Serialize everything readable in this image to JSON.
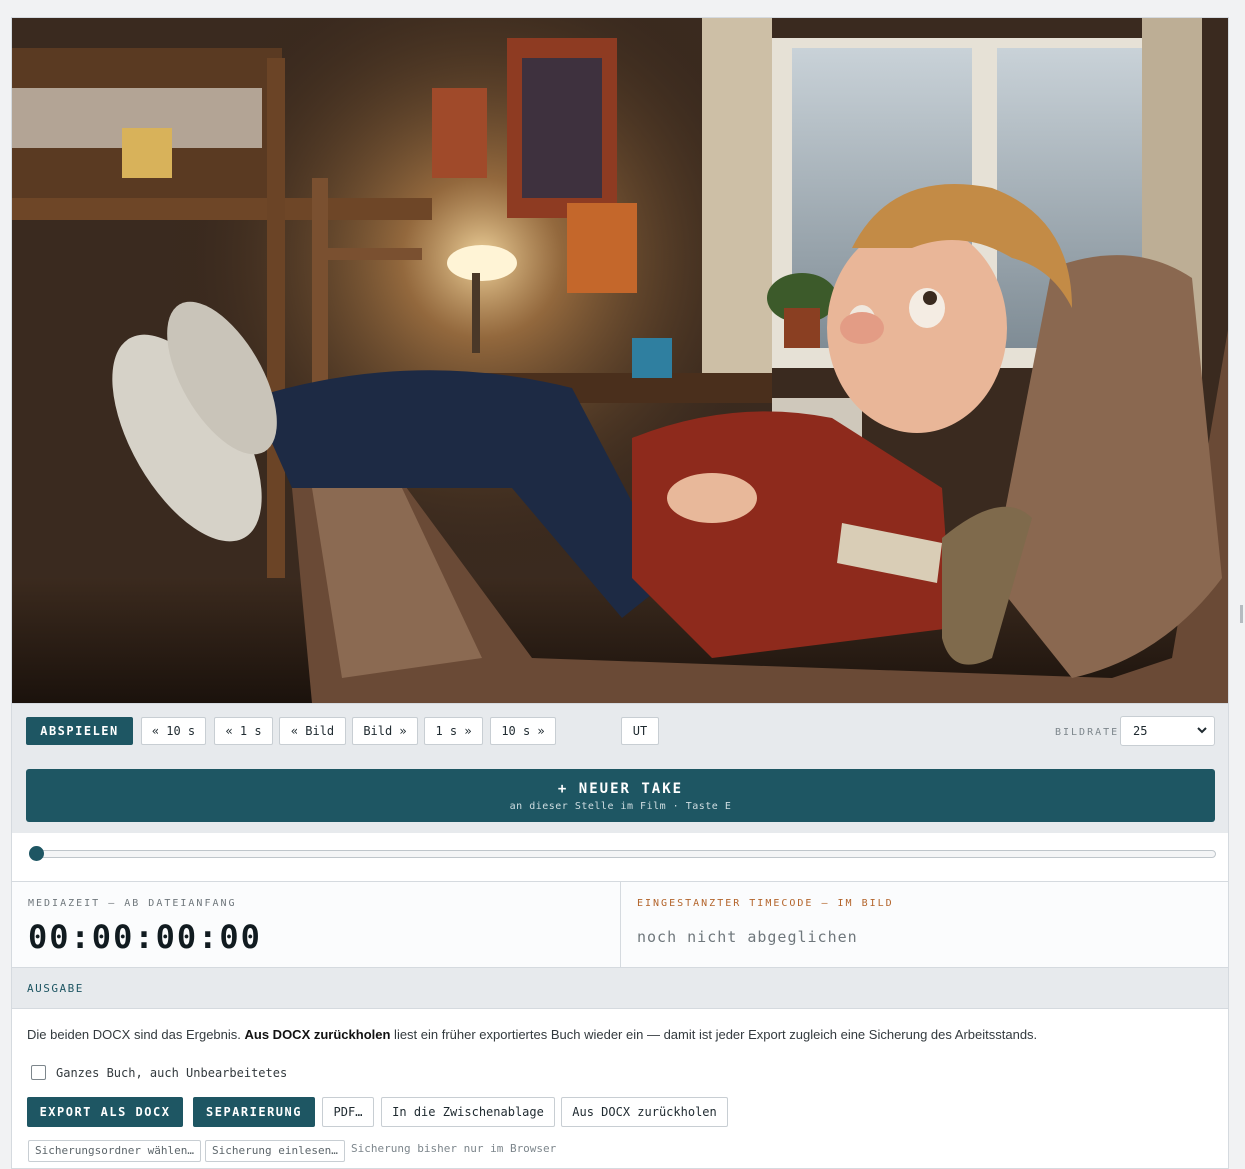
{
  "video": {
    "description_icon": "video-frame"
  },
  "transport": {
    "play_label": "ABSPIELEN",
    "back_10s": "« 10 s",
    "back_1s": "« 1 s",
    "back_frame": "« Bild",
    "fwd_frame": "Bild »",
    "fwd_1s": "1 s »",
    "fwd_10s": "10 s »",
    "subtitles_label": "UT",
    "framerate_label": "BILDRATE",
    "framerate_value": "25"
  },
  "new_take": {
    "title": "+ NEUER TAKE",
    "subtitle": "an dieser Stelle im Film · Taste E"
  },
  "position": {
    "progress": 0.0
  },
  "media_time": {
    "caption": "MEDIAZEIT — AB DATEIANFANG",
    "value": "00:00:00:00"
  },
  "burned_timecode": {
    "caption": "EINGESTANZTER TIMECODE — IM BILD",
    "value": "noch nicht abgeglichen"
  },
  "output": {
    "section_title": "AUSGABE",
    "desc_before": "Die beiden DOCX sind das Ergebnis. ",
    "desc_bold": "Aus DOCX zurückholen",
    "desc_after": " liest ein früher exportiertes Buch wieder ein — damit ist jeder Export zugleich eine Sicherung des Arbeitsstands.",
    "whole_book_label": "Ganzes Buch, auch Unbearbeitetes",
    "whole_book_checked": false,
    "export_docx": "EXPORT ALS DOCX",
    "separation": "SEPARIERUNG",
    "pdf": "PDF…",
    "clipboard": "In die Zwischenablage",
    "restore_docx": "Aus DOCX zurückholen",
    "choose_backup_folder": "Sicherungsordner wählen…",
    "load_backup": "Sicherung einlesen…",
    "backup_status": "Sicherung bisher nur im Browser"
  },
  "colors": {
    "accent": "#1e5663",
    "timecode_caption": "#b3642b"
  }
}
